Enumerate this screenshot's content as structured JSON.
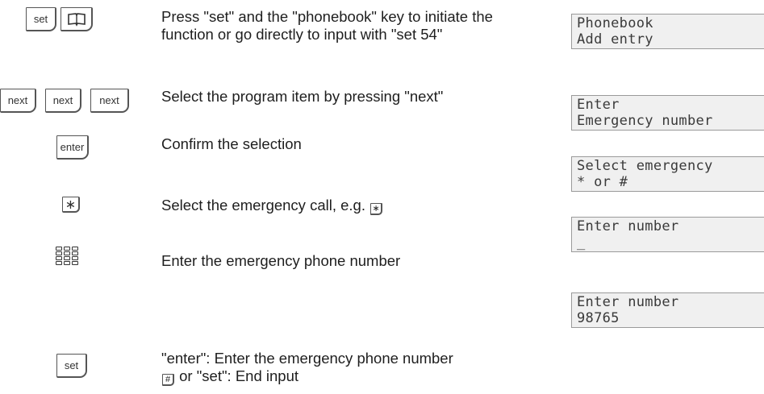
{
  "steps": [
    {
      "keys": [
        "set",
        "phonebook-icon"
      ],
      "description": "Press \"set\" and the \"phonebook\" key to initiate the function or go directly to input with \"set 54\"",
      "display": [
        "Phonebook",
        "Add entry"
      ]
    },
    {
      "keys": [
        "next",
        "next",
        "next"
      ],
      "description": "Select the program item by pressing \"next\"",
      "display": [
        "Enter",
        "Emergency number"
      ]
    },
    {
      "keys": [
        "enter"
      ],
      "description": "Confirm the selection",
      "display": [
        "Select emergency",
        "* or #"
      ]
    },
    {
      "keys": [
        "asterisk-icon"
      ],
      "description_before": "Select the emergency call, e.g.",
      "description_key_icon": "asterisk-icon",
      "display": [
        "Enter number",
        "_"
      ]
    },
    {
      "keys": [
        "keypad-icon"
      ],
      "description": "Enter the emergency phone number",
      "display": [
        "Enter number",
        "98765"
      ]
    },
    {
      "keys": [
        "set"
      ],
      "description_line1": "\"enter\": Enter the emergency phone number",
      "description_key_icon": "hash-icon",
      "description_after": "or \"set\": End input",
      "display": []
    }
  ]
}
